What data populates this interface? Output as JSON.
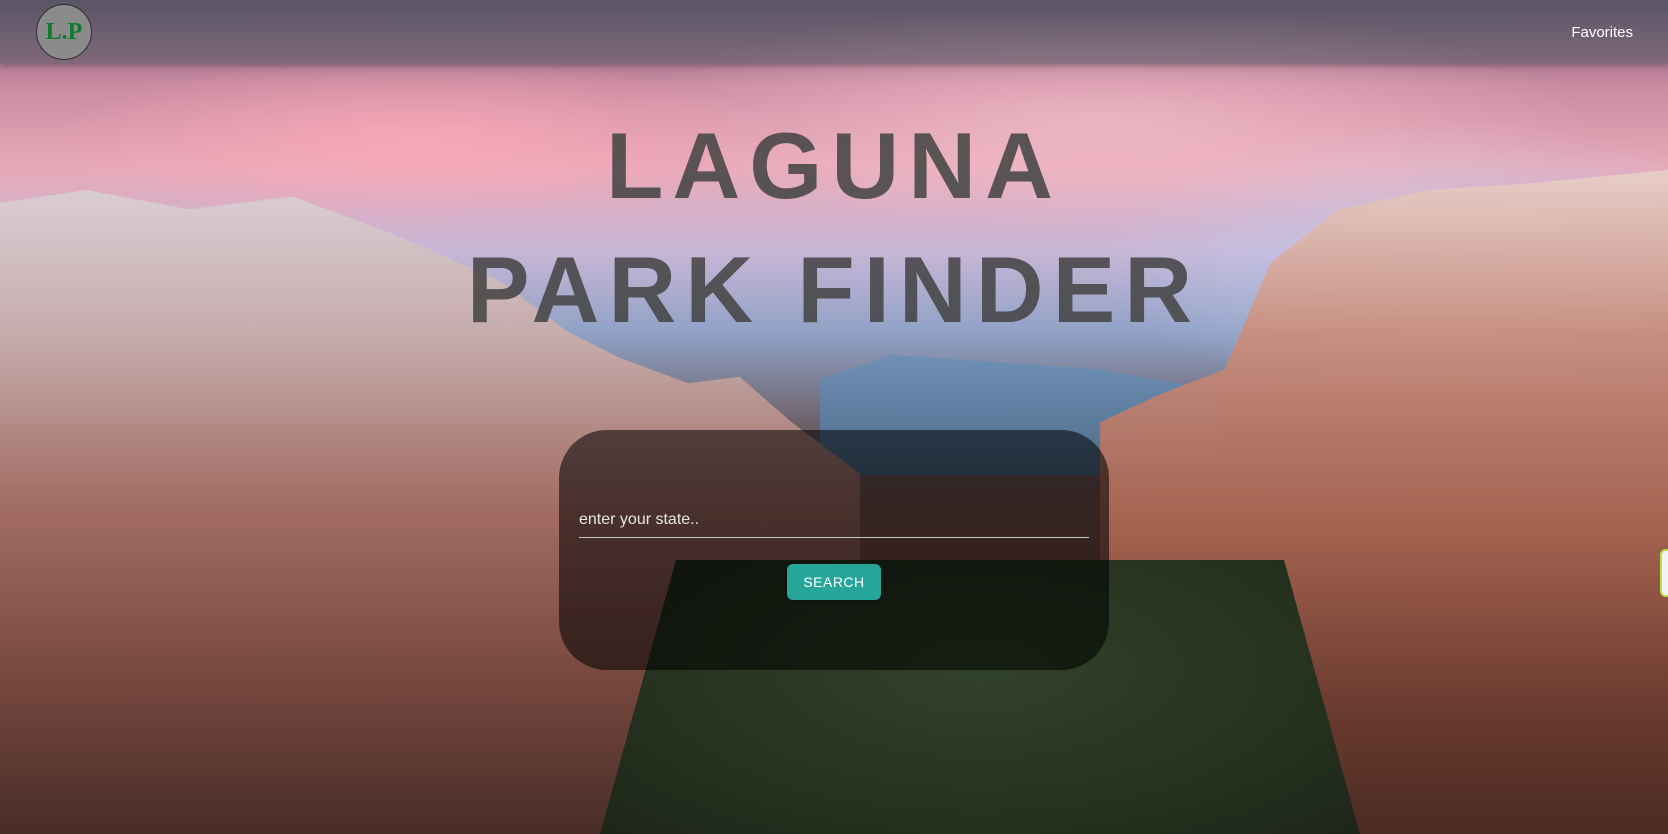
{
  "navbar": {
    "logo_text": "L.P",
    "favorites_label": "Favorites"
  },
  "hero": {
    "title_line1": "LAGUNA",
    "title_line2": "PARK FINDER"
  },
  "search": {
    "placeholder": "enter your state..",
    "value": "",
    "button_label": "SEARCH"
  },
  "colors": {
    "accent": "#26a69a",
    "logo_text": "#0d7a2e",
    "logo_bg": "#8b8b8b"
  }
}
